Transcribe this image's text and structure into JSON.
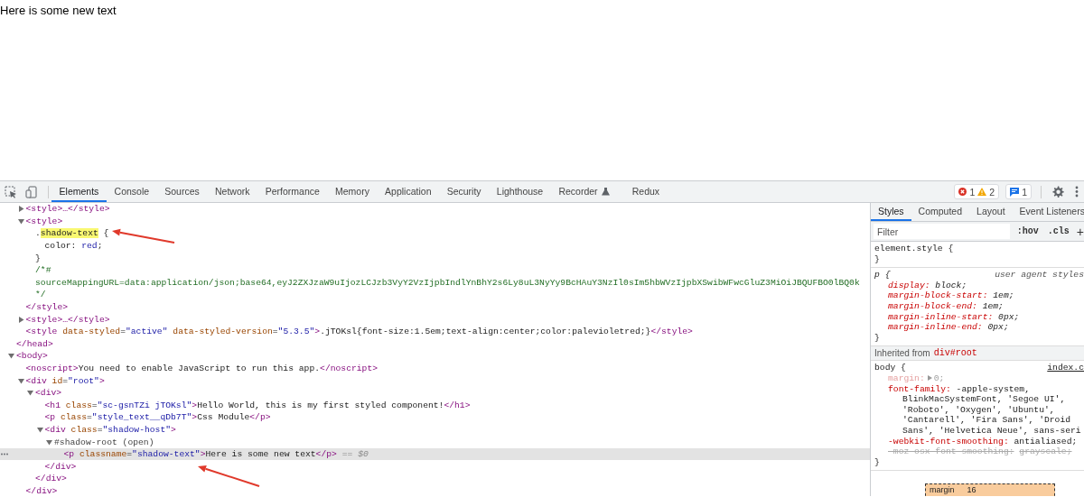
{
  "page": {
    "text": "Here is some new text"
  },
  "devtools": {
    "toolbar": {
      "tabs": [
        {
          "label": "Elements",
          "selected": true,
          "kind": "plain"
        },
        {
          "label": "Console",
          "selected": false,
          "kind": "plain"
        },
        {
          "label": "Sources",
          "selected": false,
          "kind": "plain"
        },
        {
          "label": "Network",
          "selected": false,
          "kind": "plain"
        },
        {
          "label": "Performance",
          "selected": false,
          "kind": "plain"
        },
        {
          "label": "Memory",
          "selected": false,
          "kind": "plain"
        },
        {
          "label": "Application",
          "selected": false,
          "kind": "plain"
        },
        {
          "label": "Security",
          "selected": false,
          "kind": "plain"
        },
        {
          "label": "Lighthouse",
          "selected": false,
          "kind": "plain"
        },
        {
          "label": "Recorder",
          "selected": false,
          "kind": "experimental"
        },
        {
          "label": "Redux",
          "selected": false,
          "kind": "plain"
        }
      ],
      "status_buttons": [
        {
          "counts": [
            {
              "kind": "error",
              "count": "1"
            },
            {
              "kind": "warning",
              "count": "2"
            }
          ]
        },
        {
          "counts": [
            {
              "kind": "info",
              "count": "1"
            }
          ]
        }
      ]
    },
    "elements_tree": {
      "nodes": [
        {
          "children": [
            {
              "expanded": false,
              "selected": false,
              "tokens": [
                {
                  "kind": "tag",
                  "text": "<style>…</style>"
                }
              ]
            },
            {
              "expanded": true,
              "selected": false,
              "tokens": [
                {
                  "kind": "tag",
                  "text": "<style>"
                }
              ],
              "children": [
                {
                  "selected": false,
                  "tokens": [
                    {
                      "kind": "text",
                      "text": "."
                    },
                    {
                      "kind": "highlight",
                      "text": "shadow-text"
                    },
                    {
                      "kind": "text",
                      "text": " {"
                    }
                  ],
                  "children": [
                    {
                      "selected": false,
                      "tokens": [
                        {
                          "kind": "text",
                          "text": "color: "
                        },
                        {
                          "kind": "value",
                          "text": "red"
                        },
                        {
                          "kind": "text",
                          "text": ";"
                        }
                      ]
                    }
                  ],
                  "closing": [
                    {
                      "kind": "text",
                      "text": "}"
                    }
                  ]
                },
                {
                  "selected": false,
                  "tokens": [
                    {
                      "kind": "comment",
                      "text": "/*#"
                    }
                  ]
                },
                {
                  "selected": false,
                  "tokens": [
                    {
                      "kind": "comment",
                      "text": "sourceMappingURL=data:application/json;base64,eyJ2ZXJzaW9uIjozLCJzb3VyY2VzIjpbIndlYnBhY2s6Ly8uL3NyYy9BcHAuY3NzIl0sIm5hbWVzIjpbXSwibWFwcGluZ3MiOiJBQUFBO0lBQ0k"
                    }
                  ]
                },
                {
                  "selected": false,
                  "tokens": [
                    {
                      "kind": "comment",
                      "text": "*/"
                    }
                  ]
                }
              ],
              "closing": [
                {
                  "kind": "tag",
                  "text": "</style>"
                }
              ]
            },
            {
              "expanded": false,
              "selected": false,
              "tokens": [
                {
                  "kind": "tag",
                  "text": "<style>…</style>"
                }
              ]
            },
            {
              "selected": false,
              "tokens": [
                {
                  "kind": "tag",
                  "text": "<style "
                },
                {
                  "kind": "attr",
                  "text": "data-styled"
                },
                {
                  "kind": "text",
                  "text": "="
                },
                {
                  "kind": "value",
                  "text": "\"active\" "
                },
                {
                  "kind": "attr",
                  "text": "data-styled-version"
                },
                {
                  "kind": "text",
                  "text": "="
                },
                {
                  "kind": "value",
                  "text": "\"5.3.5\""
                },
                {
                  "kind": "tag",
                  "text": ">"
                },
                {
                  "kind": "text",
                  "text": ".jTOKsl{font-size:1.5em;text-align:center;color:palevioletred;}"
                },
                {
                  "kind": "tag",
                  "text": "</style>"
                }
              ]
            }
          ],
          "closing": [
            {
              "kind": "tag",
              "text": "</head>"
            }
          ]
        },
        {
          "expanded": true,
          "selected": false,
          "tokens": [
            {
              "kind": "tag",
              "text": "<body>"
            }
          ],
          "children": [
            {
              "selected": false,
              "tokens": [
                {
                  "kind": "tag",
                  "text": "<noscript>"
                },
                {
                  "kind": "text",
                  "text": "You need to enable JavaScript to run this app."
                },
                {
                  "kind": "tag",
                  "text": "</noscript>"
                }
              ]
            },
            {
              "expanded": true,
              "selected": false,
              "tokens": [
                {
                  "kind": "tag",
                  "text": "<div "
                },
                {
                  "kind": "attr",
                  "text": "id"
                },
                {
                  "kind": "text",
                  "text": "="
                },
                {
                  "kind": "value",
                  "text": "\"root\""
                },
                {
                  "kind": "tag",
                  "text": ">"
                }
              ],
              "children": [
                {
                  "expanded": true,
                  "selected": false,
                  "tokens": [
                    {
                      "kind": "tag",
                      "text": "<div>"
                    }
                  ],
                  "children": [
                    {
                      "selected": false,
                      "tokens": [
                        {
                          "kind": "tag",
                          "text": "<h1 "
                        },
                        {
                          "kind": "attr",
                          "text": "class"
                        },
                        {
                          "kind": "text",
                          "text": "="
                        },
                        {
                          "kind": "value",
                          "text": "\"sc-gsnTZi jTOKsl\""
                        },
                        {
                          "kind": "tag",
                          "text": ">"
                        },
                        {
                          "kind": "text",
                          "text": "Hello World, this is my first styled component!"
                        },
                        {
                          "kind": "tag",
                          "text": "</h1>"
                        }
                      ]
                    },
                    {
                      "selected": false,
                      "tokens": [
                        {
                          "kind": "tag",
                          "text": "<p "
                        },
                        {
                          "kind": "attr",
                          "text": "class"
                        },
                        {
                          "kind": "text",
                          "text": "="
                        },
                        {
                          "kind": "value",
                          "text": "\"style_text__qDb7T\""
                        },
                        {
                          "kind": "tag",
                          "text": ">"
                        },
                        {
                          "kind": "text",
                          "text": "Css Module"
                        },
                        {
                          "kind": "tag",
                          "text": "</p>"
                        }
                      ]
                    },
                    {
                      "expanded": true,
                      "selected": false,
                      "tokens": [
                        {
                          "kind": "tag",
                          "text": "<div "
                        },
                        {
                          "kind": "attr",
                          "text": "class"
                        },
                        {
                          "kind": "text",
                          "text": "="
                        },
                        {
                          "kind": "value",
                          "text": "\"shadow-host\""
                        },
                        {
                          "kind": "tag",
                          "text": ">"
                        }
                      ],
                      "children": [
                        {
                          "expanded": true,
                          "selected": false,
                          "tokens": [
                            {
                              "kind": "pseudo",
                              "text": "#shadow-root (open)"
                            }
                          ],
                          "children": [
                            {
                              "selected": true,
                              "tokens": [
                                {
                                  "kind": "tag",
                                  "text": "<p "
                                },
                                {
                                  "kind": "attr",
                                  "text": "classname"
                                },
                                {
                                  "kind": "text",
                                  "text": "="
                                },
                                {
                                  "kind": "value",
                                  "text": "\"shadow-text\""
                                },
                                {
                                  "kind": "tag",
                                  "text": ">"
                                },
                                {
                                  "kind": "text",
                                  "text": "Here is some new text"
                                },
                                {
                                  "kind": "tag",
                                  "text": "</p>"
                                },
                                {
                                  "kind": "console-ref",
                                  "text": " == $0"
                                }
                              ]
                            }
                          ]
                        }
                      ],
                      "closing": [
                        {
                          "kind": "tag",
                          "text": "</div>"
                        }
                      ]
                    }
                  ],
                  "closing": [
                    {
                      "kind": "tag",
                      "text": "</div>"
                    }
                  ]
                }
              ],
              "closing": [
                {
                  "kind": "tag",
                  "text": "</div>"
                }
              ]
            }
          ]
        }
      ]
    },
    "styles_pane": {
      "tabs": [
        {
          "label": "Styles",
          "selected": true
        },
        {
          "label": "Computed",
          "selected": false
        },
        {
          "label": "Layout",
          "selected": false
        },
        {
          "label": "Event Listeners",
          "selected": false
        }
      ],
      "filter": {
        "placeholder": "Filter"
      },
      "hov_button": ":hov",
      "cls_button": ".cls",
      "add_button": "+",
      "rules": [
        {
          "kind": "rule",
          "selector": "element.style {",
          "closing": "}"
        },
        {
          "kind": "rule",
          "selector": "p {",
          "source": {
            "kind": "user-agent",
            "text": "user agent styles"
          },
          "closing": "}",
          "declarations": [
            {
              "property": "display:",
              "value": "block;",
              "kind": "active",
              "expandable": false
            },
            {
              "property": "margin-block-start:",
              "value": "1em;",
              "kind": "active",
              "expandable": false
            },
            {
              "property": "margin-block-end:",
              "value": "1em;",
              "kind": "active",
              "expandable": false
            },
            {
              "property": "margin-inline-start:",
              "value": "0px;",
              "kind": "active",
              "expandable": false
            },
            {
              "property": "margin-inline-end:",
              "value": "0px;",
              "kind": "active",
              "expandable": false
            }
          ]
        },
        {
          "kind": "inherited",
          "label": "Inherited from",
          "element": "div#root"
        },
        {
          "kind": "rule",
          "selector": "body {",
          "source": {
            "kind": "link",
            "text": "index.c"
          },
          "closing": "}",
          "declarations": [
            {
              "property": "margin:",
              "value": "0;",
              "kind": "inactive",
              "expandable": true
            },
            {
              "property": "font-family:",
              "value": "-apple-system, BlinkMacSystemFont, 'Segoe UI', 'Roboto', 'Oxygen', 'Ubuntu', 'Cantarell', 'Fira Sans', 'Droid Sans', 'Helvetica Neue', sans-seri",
              "kind": "active",
              "expandable": false
            },
            {
              "property": "-webkit-font-smoothing:",
              "value": "antialiased;",
              "kind": "active",
              "expandable": false
            },
            {
              "property": "-moz-osx-font-smoothing:",
              "value": "grayscale;",
              "kind": "overridden",
              "expandable": false
            }
          ]
        }
      ],
      "box_model": {
        "label": "margin",
        "value": "16"
      }
    }
  }
}
